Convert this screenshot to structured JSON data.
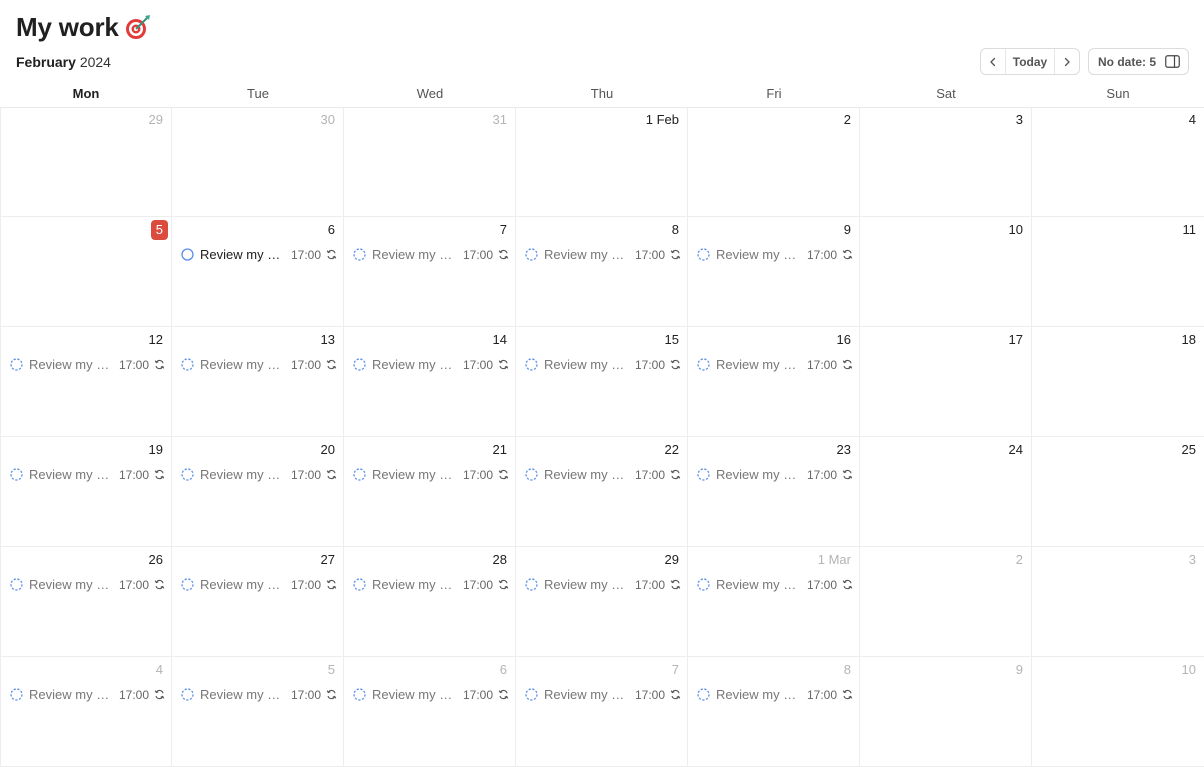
{
  "header": {
    "title": "My work",
    "title_icon": "target-icon"
  },
  "toolbar": {
    "month": "February",
    "year": "2024",
    "today_label": "Today",
    "no_date_label": "No date: 5"
  },
  "weekdays": [
    "Mon",
    "Tue",
    "Wed",
    "Thu",
    "Fri",
    "Sat",
    "Sun"
  ],
  "current_weekday_index": 0,
  "colors": {
    "today_badge": "#dc4c3e",
    "task_circle": "#5a8fe8",
    "other_month_text": "#b4b4b4"
  },
  "weeks": [
    [
      {
        "label": "29",
        "other": true
      },
      {
        "label": "30",
        "other": true
      },
      {
        "label": "31",
        "other": true
      },
      {
        "label": "1 Feb"
      },
      {
        "label": "2"
      },
      {
        "label": "3"
      },
      {
        "label": "4"
      }
    ],
    [
      {
        "label": "5",
        "today": true
      },
      {
        "label": "6",
        "task": {
          "name": "Review my d...",
          "time": "17:00",
          "active": true
        }
      },
      {
        "label": "7",
        "task": {
          "name": "Review my d...",
          "time": "17:00"
        }
      },
      {
        "label": "8",
        "task": {
          "name": "Review my d...",
          "time": "17:00"
        }
      },
      {
        "label": "9",
        "task": {
          "name": "Review my d...",
          "time": "17:00"
        }
      },
      {
        "label": "10"
      },
      {
        "label": "11"
      }
    ],
    [
      {
        "label": "12",
        "task": {
          "name": "Review my d...",
          "time": "17:00"
        }
      },
      {
        "label": "13",
        "task": {
          "name": "Review my d...",
          "time": "17:00"
        }
      },
      {
        "label": "14",
        "task": {
          "name": "Review my d...",
          "time": "17:00"
        }
      },
      {
        "label": "15",
        "task": {
          "name": "Review my d...",
          "time": "17:00"
        }
      },
      {
        "label": "16",
        "task": {
          "name": "Review my d...",
          "time": "17:00"
        }
      },
      {
        "label": "17"
      },
      {
        "label": "18"
      }
    ],
    [
      {
        "label": "19",
        "task": {
          "name": "Review my d...",
          "time": "17:00"
        }
      },
      {
        "label": "20",
        "task": {
          "name": "Review my d...",
          "time": "17:00"
        }
      },
      {
        "label": "21",
        "task": {
          "name": "Review my d...",
          "time": "17:00"
        }
      },
      {
        "label": "22",
        "task": {
          "name": "Review my d...",
          "time": "17:00"
        }
      },
      {
        "label": "23",
        "task": {
          "name": "Review my d...",
          "time": "17:00"
        }
      },
      {
        "label": "24"
      },
      {
        "label": "25"
      }
    ],
    [
      {
        "label": "26",
        "task": {
          "name": "Review my d...",
          "time": "17:00"
        }
      },
      {
        "label": "27",
        "task": {
          "name": "Review my d...",
          "time": "17:00"
        }
      },
      {
        "label": "28",
        "task": {
          "name": "Review my d...",
          "time": "17:00"
        }
      },
      {
        "label": "29",
        "task": {
          "name": "Review my d...",
          "time": "17:00"
        }
      },
      {
        "label": "1 Mar",
        "other": true,
        "task": {
          "name": "Review my d...",
          "time": "17:00"
        }
      },
      {
        "label": "2",
        "other": true
      },
      {
        "label": "3",
        "other": true
      }
    ],
    [
      {
        "label": "4",
        "other": true,
        "task": {
          "name": "Review my d...",
          "time": "17:00"
        }
      },
      {
        "label": "5",
        "other": true,
        "task": {
          "name": "Review my d...",
          "time": "17:00"
        }
      },
      {
        "label": "6",
        "other": true,
        "task": {
          "name": "Review my d...",
          "time": "17:00"
        }
      },
      {
        "label": "7",
        "other": true,
        "task": {
          "name": "Review my d...",
          "time": "17:00"
        }
      },
      {
        "label": "8",
        "other": true,
        "task": {
          "name": "Review my d...",
          "time": "17:00"
        }
      },
      {
        "label": "9",
        "other": true
      },
      {
        "label": "10",
        "other": true
      }
    ]
  ]
}
